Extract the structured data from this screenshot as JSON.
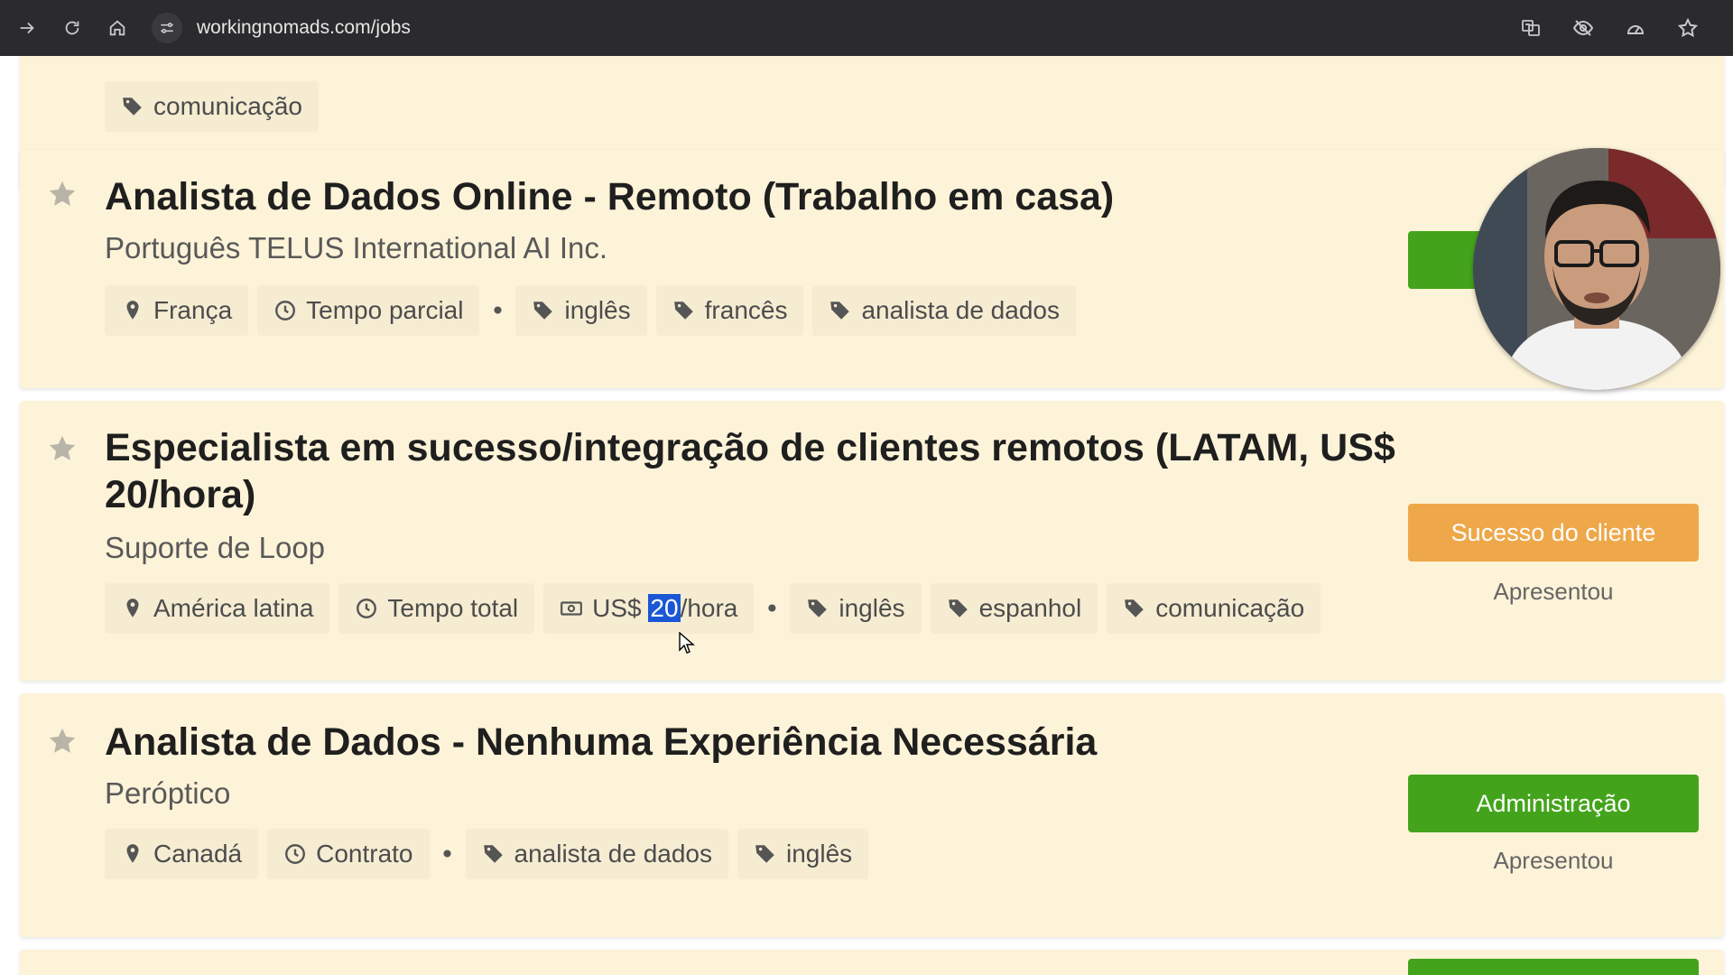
{
  "browser": {
    "url": "workingnomads.com/jobs",
    "icons": [
      "forward-icon",
      "reload-icon",
      "home-icon",
      "site-info-icon",
      "translate-icon",
      "eye-off-icon",
      "performance-icon",
      "bookmark-star-icon"
    ]
  },
  "jobs": [
    {
      "tags": [
        {
          "icon": "tag-icon",
          "label": "comunicação"
        }
      ]
    },
    {
      "title": "Analista de Dados Online - Remoto (Trabalho em casa)",
      "company": "Português TELUS International AI Inc.",
      "location": "França",
      "schedule": "Tempo parcial",
      "tags": [
        "inglês",
        "francês",
        "analista de dados"
      ]
    },
    {
      "title": "Especialista em sucesso/integração de clientes remotos (LATAM, US$ 20/hora)",
      "company": "Suporte de Loop",
      "location": "América latina",
      "schedule": "Tempo total",
      "salary_prefix": "US$ ",
      "salary_highlight": "20",
      "salary_suffix": "/hora",
      "tags": [
        "inglês",
        "espanhol",
        "comunicação"
      ],
      "category": "Sucesso do cliente",
      "featured": "Apresentou"
    },
    {
      "title": "Analista de Dados - Nenhuma Experiência Necessária",
      "company": "Peróptico",
      "location": "Canadá",
      "schedule": "Contrato",
      "tags": [
        "analista de dados",
        "inglês"
      ],
      "category": "Administração",
      "featured": "Apresentou"
    }
  ],
  "colors": {
    "card_bg": "#fdf3d8",
    "tag_bg": "#f5ecd2",
    "green": "#43a41b",
    "orange": "#eea84a",
    "highlight": "#1a56d6"
  }
}
